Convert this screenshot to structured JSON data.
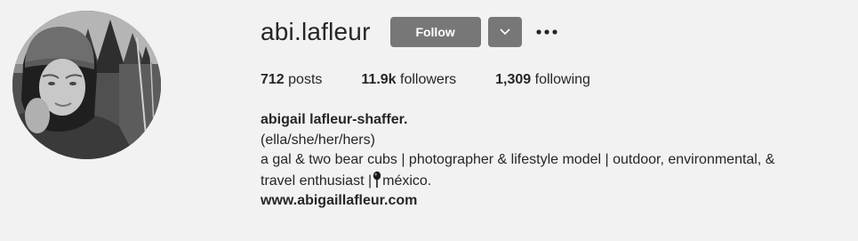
{
  "profile": {
    "username": "abi.lafleur",
    "follow_label": "Follow",
    "stats": {
      "posts_count": "712",
      "posts_label": "posts",
      "followers_count": "11.9k",
      "followers_label": "followers",
      "following_count": "1,309",
      "following_label": "following"
    },
    "bio": {
      "full_name": "abigail lafleur-shaffer.",
      "pronouns": "(ella/she/her/hers)",
      "line1": "a gal & two bear cubs | photographer & lifestyle model | outdoor, environmental, &",
      "line2_prefix": "travel enthusiast |",
      "line2_suffix": "méxico.",
      "website": "www.abigaillafleur.com"
    }
  },
  "icons": {
    "dropdown": "chevron-down-icon",
    "more": "more-options-icon",
    "location": "round-pushpin-icon"
  },
  "colors": {
    "page_background": "#f2f2f2",
    "button_background": "#777777",
    "text": "#262626"
  }
}
